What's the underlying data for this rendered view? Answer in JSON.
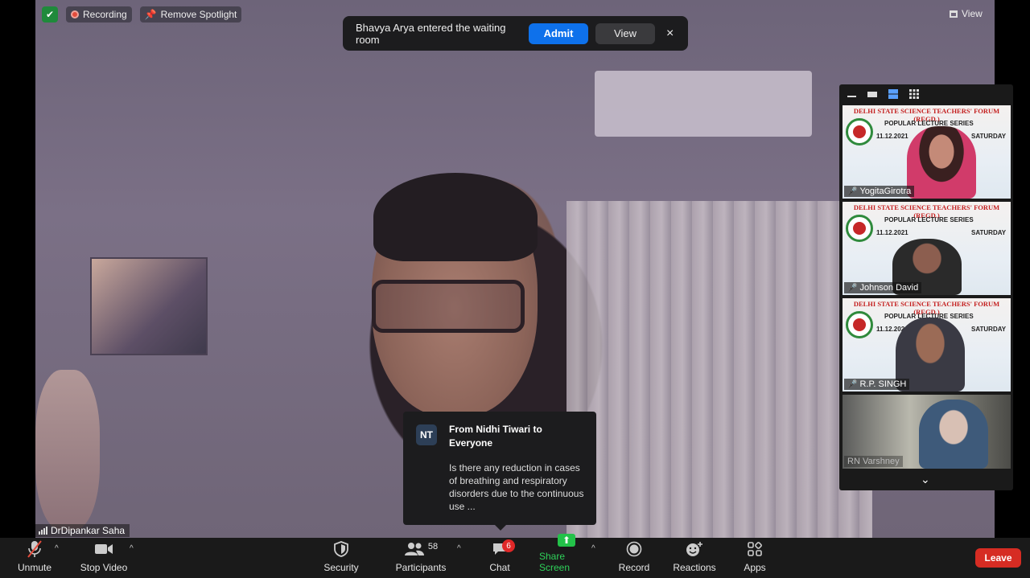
{
  "status": {
    "recording_label": "Recording",
    "spotlight_label": "Remove Spotlight",
    "view_label": "View"
  },
  "waiting_room": {
    "message": "Bhavya Arya entered the waiting room",
    "admit_label": "Admit",
    "view_label": "View",
    "close_glyph": "×"
  },
  "main_video": {
    "participant_name": "DrDipankar Saha"
  },
  "gallery": {
    "tiles": [
      {
        "banner": "DELHI STATE SCIENCE TEACHERS' FORUM (REGD.)",
        "series": "POPULAR LECTURE SERIES",
        "date": "11.12.2021",
        "day": "SATURDAY",
        "name": "YogitaGirotra"
      },
      {
        "banner": "DELHI STATE SCIENCE TEACHERS' FORUM (REGD.)",
        "series": "POPULAR LECTURE SERIES",
        "date": "11.12.2021",
        "day": "SATURDAY",
        "name": "Johnson David"
      },
      {
        "banner": "DELHI STATE SCIENCE TEACHERS' FORUM (REGD.)",
        "series": "POPULAR LECTURE SERIES",
        "date": "11.12.2021",
        "day": "SATURDAY",
        "name": "R.P. SINGH"
      },
      {
        "name": "RN Varshney"
      }
    ]
  },
  "chat_popup": {
    "avatar_initials": "NT",
    "from": "From Nidhi Tiwari to Everyone",
    "message": "Is there any reduction in cases of breathing and respiratory disorders due to the continuous use ..."
  },
  "toolbar": {
    "unmute_label": "Unmute",
    "stop_video_label": "Stop Video",
    "security_label": "Security",
    "participants_label": "Participants",
    "participants_count": "58",
    "chat_label": "Chat",
    "chat_badge": "6",
    "share_screen_label": "Share Screen",
    "record_label": "Record",
    "reactions_label": "Reactions",
    "apps_label": "Apps",
    "leave_label": "Leave"
  },
  "colors": {
    "accent_blue": "#0e71eb",
    "leave_red": "#d62c23",
    "share_green": "#23c249",
    "toolbar_bg": "#1a1a1a"
  }
}
